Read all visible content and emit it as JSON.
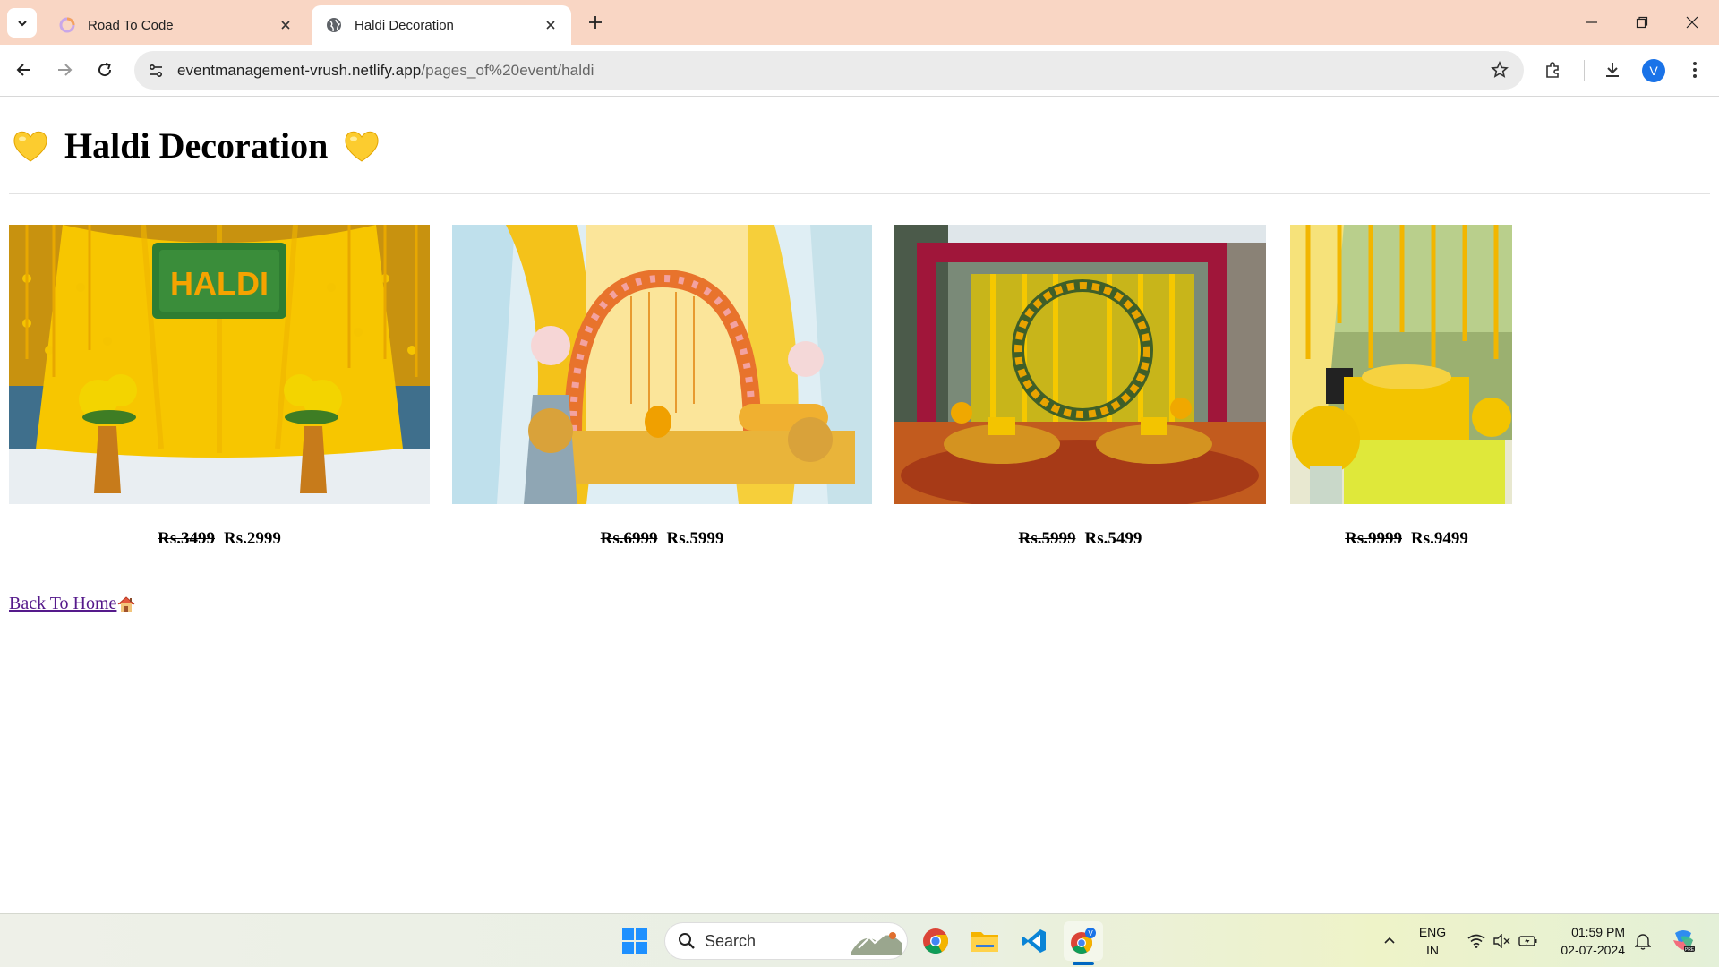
{
  "browser": {
    "tabs": [
      {
        "title": "Road To Code",
        "active": false
      },
      {
        "title": "Haldi Decoration",
        "active": true
      }
    ],
    "url_host": "eventmanagement-vrush.netlify.app",
    "url_path": "/pages_of%20event/haldi",
    "profile_initial": "V"
  },
  "page": {
    "title": "Haldi Decoration",
    "heading_emoji": "yellow-heart",
    "products": [
      {
        "old_price": "Rs.3499",
        "new_price": "Rs.2999",
        "image": "haldi-sign-backdrop"
      },
      {
        "old_price": "Rs.6999",
        "new_price": "Rs.5999",
        "image": "floral-arch-stage"
      },
      {
        "old_price": "Rs.5999",
        "new_price": "Rs.5499",
        "image": "marigold-ring-setup"
      },
      {
        "old_price": "Rs.9999",
        "new_price": "Rs.9499",
        "image": "marigold-curtain-seat"
      }
    ],
    "back_link": "Back To Home",
    "back_link_icon": "house-emoji"
  },
  "taskbar": {
    "search_placeholder": "Search",
    "language": "ENG",
    "region": "IN",
    "time": "01:59 PM",
    "date": "02-07-2024",
    "apps": [
      "windows-start",
      "chrome",
      "file-explorer",
      "vscode",
      "chrome-profile"
    ]
  },
  "colors": {
    "tabbar_bg": "#f9d6c4",
    "link_visited": "#551a8b",
    "marigold": "#f5c400"
  }
}
